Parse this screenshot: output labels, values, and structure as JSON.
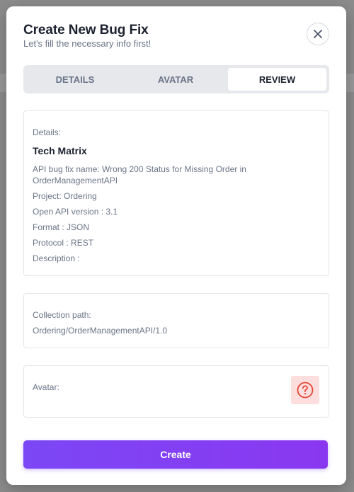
{
  "modal": {
    "title": "Create New Bug Fix",
    "subtitle": "Let's fill the necessary info first!",
    "close_icon": "close-icon"
  },
  "tabs": [
    {
      "label": "DETAILS",
      "active": false
    },
    {
      "label": "AVATAR",
      "active": false
    },
    {
      "label": "REVIEW",
      "active": true
    }
  ],
  "details": {
    "heading": "Details:",
    "name": "Tech Matrix",
    "bug_fix_name": "API bug fix name: Wrong 200 Status for Missing Order in OrderManagementAPI",
    "project": "Project: Ordering",
    "openapi_version": "Open API version : 3.1",
    "format": "Format : JSON",
    "protocol": "Protocol : REST",
    "description": "Description :"
  },
  "collection": {
    "heading": "Collection path:",
    "path": "Ordering/OrderManagementAPI/1.0"
  },
  "avatar": {
    "heading": "Avatar:",
    "icon": "question-circle-icon",
    "icon_color": "#e5493a",
    "bg_color": "#fbdedd"
  },
  "actions": {
    "create_label": "Create"
  },
  "colors": {
    "accent": "#7c47f5",
    "title": "#1d2230",
    "muted": "#6a7487"
  }
}
